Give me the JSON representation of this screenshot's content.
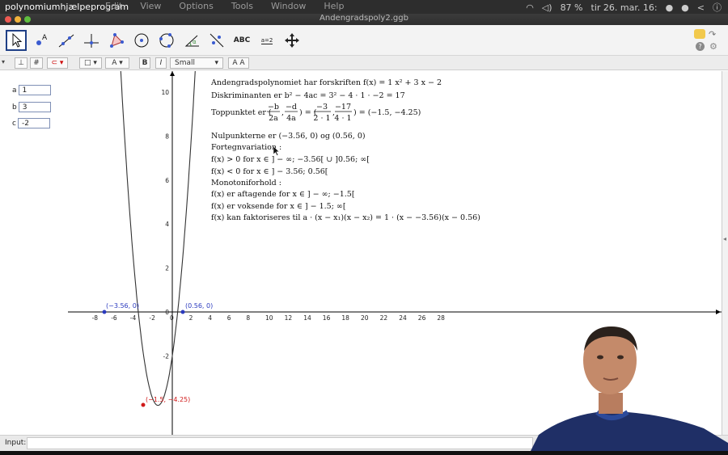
{
  "menubar": {
    "app_name": "polynomiumhjælpeprogram",
    "menus": [
      "Edit",
      "View",
      "Options",
      "Tools",
      "Window",
      "Help"
    ],
    "battery": "87 %",
    "clock": "tir 26. mar. 16:"
  },
  "window": {
    "title": "Andengradspoly2.ggb"
  },
  "toolbar": {
    "tools": [
      "move-tool",
      "point-tool",
      "line-tool",
      "perpendicular-tool",
      "polygon-tool",
      "circle-tool",
      "circle-3pt-tool",
      "angle-tool",
      "reflect-tool",
      "text-tool",
      "slider-tool",
      "move-view-tool"
    ],
    "text_tool_label": "ABC",
    "slider_tool_label": "a=2"
  },
  "stylebar": {
    "bold_label": "B",
    "italic_label": "I",
    "size_label": "Small",
    "aa_label": "A A"
  },
  "algebra": {
    "rows": [
      {
        "name": "a",
        "value": "1"
      },
      {
        "name": "b",
        "value": "3"
      },
      {
        "name": "c",
        "value": "-2"
      }
    ]
  },
  "graph": {
    "x_ticks": [
      "-8",
      "-6",
      "-4",
      "-2",
      "0",
      "2",
      "4",
      "6",
      "8",
      "10",
      "12",
      "14",
      "16",
      "18",
      "20",
      "22",
      "24",
      "26",
      "28"
    ],
    "y_ticks": [
      "10",
      "8",
      "6",
      "4",
      "2",
      "0",
      "-2"
    ],
    "points": [
      {
        "label": "(−3.56, 0)",
        "color": "#2b3bbf"
      },
      {
        "label": "(0.56, 0)",
        "color": "#2b3bbf"
      },
      {
        "label": "(−1.5, −4.25)",
        "color": "#d01a1a"
      }
    ],
    "text_lines": [
      "Andengradspolynomiet har forskriften f(x) = 1 x² + 3 x − 2",
      "Diskriminanten er b² − 4ac = 3² − 4 · 1 · −2 = 17",
      "Toppunktet er (−b/2a, −d/4a) = (−3/2·1, −17/4·1) = (−1.5, −4.25)",
      "Nulpunkterne er (−3.56, 0) og (0.56, 0)",
      "Fortegnvariation :",
      "f(x) > 0 for x ∈ ] − ∞; −3.56[ ∪ ]0.56; ∞[",
      "f(x) < 0 for x ∈ ] − 3.56; 0.56[",
      "Monotoniforhold :",
      "f(x) er aftagende for x ∈ ] − ∞; −1.5[",
      "f(x) er voksende for x ∈ ] − 1.5; ∞[",
      "f(x) kan faktoriseres til a · (x − x₁)(x − x₂) = 1 · (x − −3.56)(x − 0.56)"
    ],
    "frac": {
      "n1": "−b",
      "d1": "2a",
      "n2": "−d",
      "d2": "4a",
      "n3": "−3",
      "d3": "2 · 1",
      "n4": "−17",
      "d4": "4 · 1"
    }
  },
  "inputbar": {
    "label": "Input:"
  }
}
